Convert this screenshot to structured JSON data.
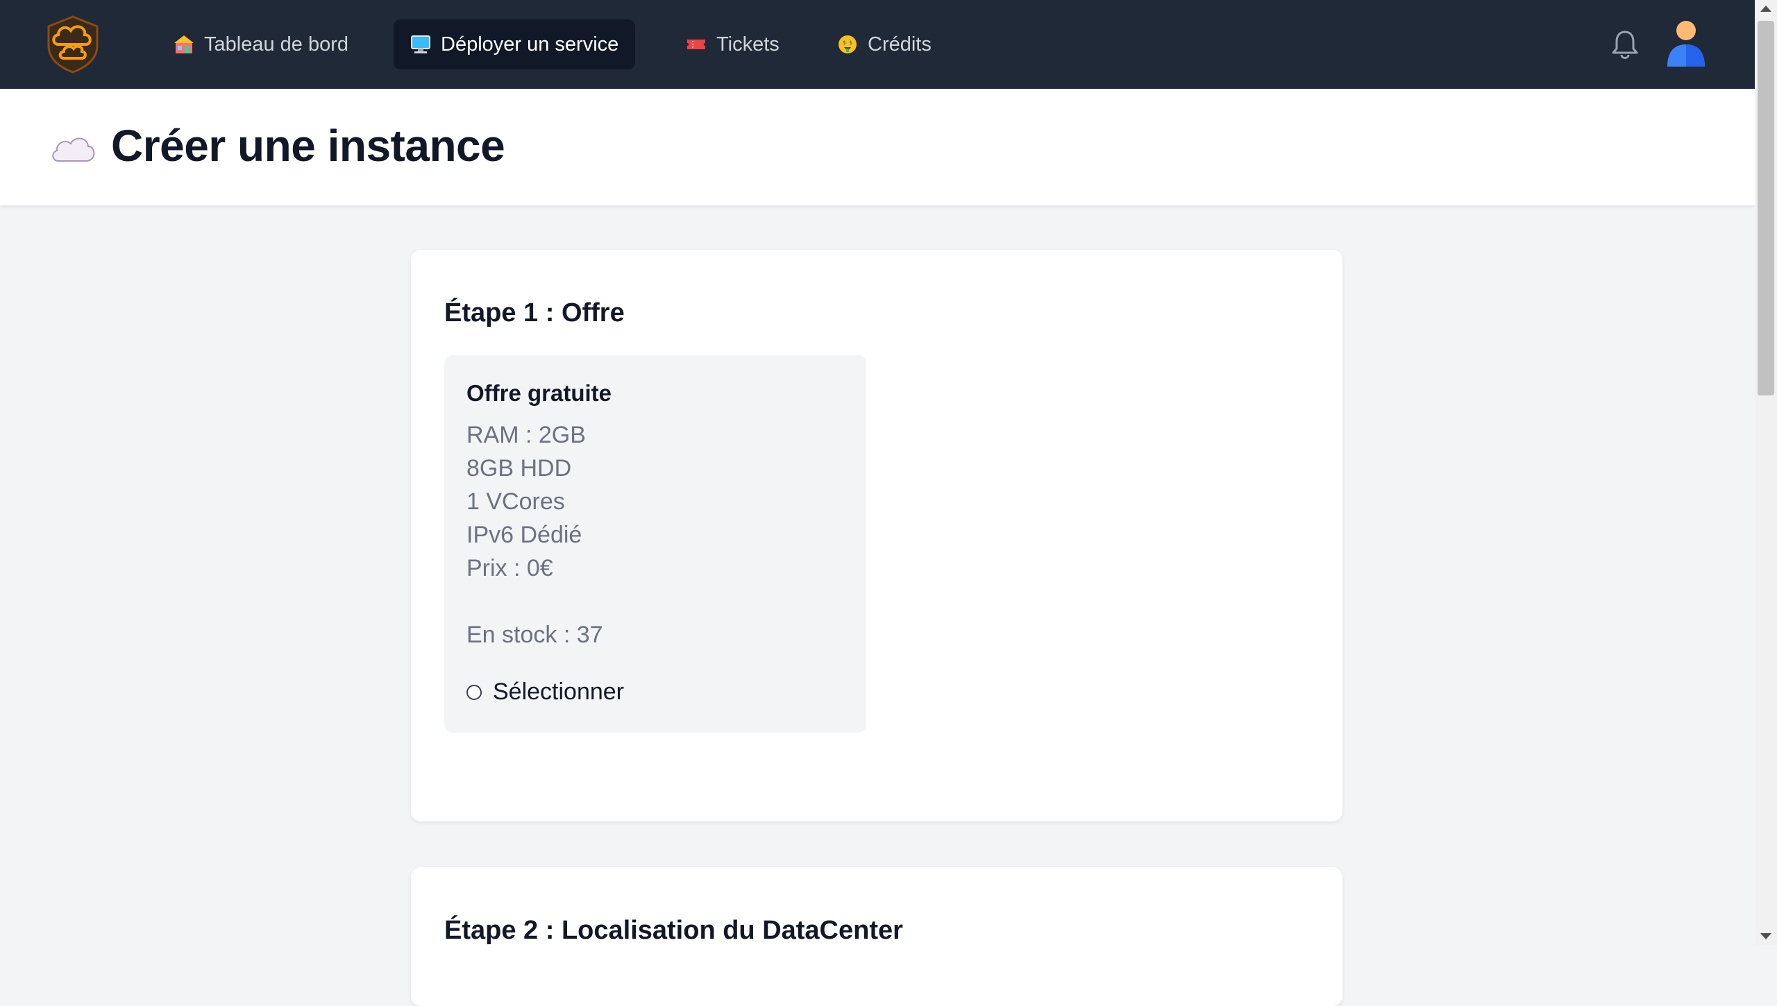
{
  "nav": {
    "items": [
      {
        "label": "Tableau de bord",
        "icon": "house-icon",
        "active": false
      },
      {
        "label": "Déployer un service",
        "icon": "desktop-computer-icon",
        "active": true
      },
      {
        "label": "Tickets",
        "icon": "ticket-icon",
        "active": false
      },
      {
        "label": "Crédits",
        "icon": "money-face-icon",
        "active": false
      }
    ],
    "logo_icon": "cloud-shield-logo",
    "notification_icon": "bell-icon",
    "user_icon": "user-avatar-icon"
  },
  "header": {
    "title": "Créer une instance",
    "icon": "cloud-icon"
  },
  "step1": {
    "title": "Étape 1 : Offre",
    "offer": {
      "name": "Offre gratuite",
      "specs": [
        "RAM : 2GB",
        "8GB HDD",
        "1 VCores",
        "IPv6 Dédié",
        "Prix : 0€"
      ],
      "stock": "En stock : 37",
      "select_label": "Sélectionner",
      "selected": false
    }
  },
  "step2": {
    "title": "Étape 2 : Localisation du DataCenter"
  },
  "colors": {
    "nav_bg": "#1f2937",
    "active_tab_bg": "#111827",
    "page_bg": "#f3f4f6",
    "logo_orange": "#f59e0b",
    "avatar_blue": "#3b82f6"
  }
}
